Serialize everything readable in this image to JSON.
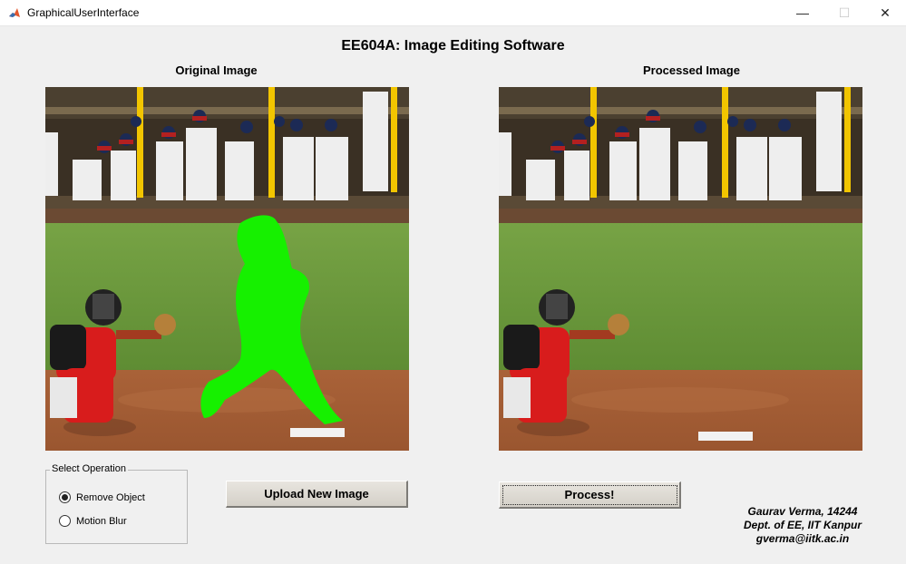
{
  "window": {
    "title": "GraphicalUserInterface",
    "minimize_glyph": "—",
    "maximize_glyph": "☐",
    "close_glyph": "✕",
    "icon": "matlab-icon"
  },
  "app": {
    "heading": "EE604A: Image Editing Software"
  },
  "original": {
    "title": "Original Image"
  },
  "processed": {
    "title": "Processed Image"
  },
  "operation_group": {
    "legend": "Select Operation",
    "options": [
      {
        "label": "Remove Object",
        "selected": true
      },
      {
        "label": "Motion Blur",
        "selected": false
      }
    ]
  },
  "buttons": {
    "upload": "Upload New Image",
    "process": "Process!"
  },
  "credits": {
    "line1": "Gaurav Verma, 14244",
    "line2": "Dept. of EE, IIT Kanpur",
    "line3": "gverma@iitk.ac.in"
  },
  "colors": {
    "mask_green": "#16f000",
    "jersey_red": "#d81c1c",
    "grass": "#6e9a3c",
    "dirt": "#a45d36",
    "dugout": "#3c3426",
    "pole_yellow": "#f2c500"
  }
}
